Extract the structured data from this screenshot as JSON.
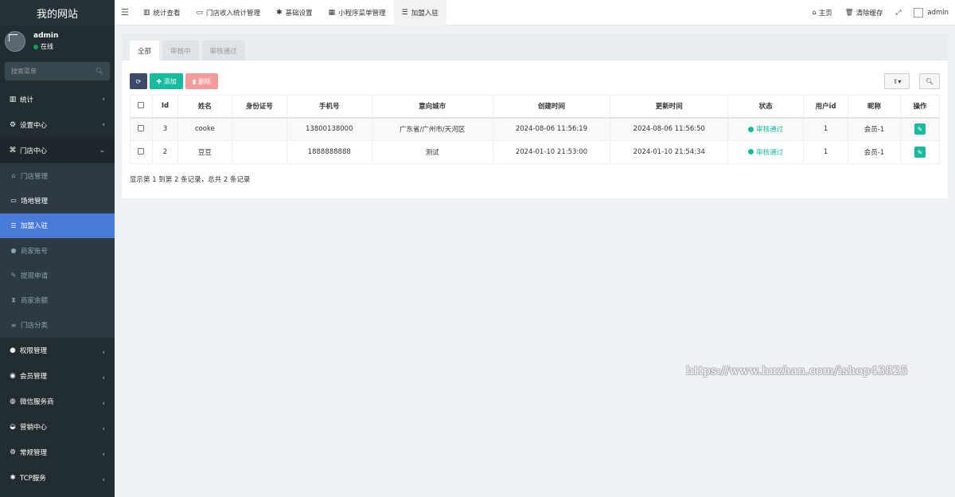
{
  "sidebar": {
    "logo": "我的网站",
    "user": {
      "name": "admin",
      "status": "在线"
    },
    "search_placeholder": "搜索菜单",
    "items": [
      {
        "label": "统计",
        "icon": "bar-chart-icon"
      },
      {
        "label": "设置中心",
        "icon": "cogs-icon"
      },
      {
        "label": "门店中心",
        "icon": "store-icon"
      }
    ],
    "sub_items": [
      {
        "label": "门店管理",
        "icon": "home-icon"
      },
      {
        "label": "场地管理",
        "icon": "laptop-icon"
      },
      {
        "label": "加盟入驻",
        "icon": "list-alt-icon"
      },
      {
        "label": "商家账号",
        "icon": "user-icon"
      },
      {
        "label": "提现申请",
        "icon": "edit-icon"
      },
      {
        "label": "商家余额",
        "icon": "hourglass-icon"
      },
      {
        "label": "门店分类",
        "icon": "list-icon"
      }
    ],
    "groups": [
      {
        "label": "权限管理",
        "icon": "group-icon"
      },
      {
        "label": "会员管理",
        "icon": "user-circle-icon"
      },
      {
        "label": "微信服务商",
        "icon": "wechat-icon"
      },
      {
        "label": "营销中心",
        "icon": "car-icon"
      },
      {
        "label": "常规管理",
        "icon": "cogs-icon"
      },
      {
        "label": "TCP服务",
        "icon": "asterisk-icon"
      }
    ]
  },
  "topbar": {
    "tabs": [
      {
        "label": "统计查看",
        "icon": "area-chart-icon"
      },
      {
        "label": "门店收入统计管理",
        "icon": "window-icon"
      },
      {
        "label": "基础设置",
        "icon": "asterisk-icon"
      },
      {
        "label": "小程序菜单管理",
        "icon": "th-large-icon"
      },
      {
        "label": "加盟入驻",
        "icon": "list-alt-icon"
      }
    ],
    "home": "主页",
    "clear_cache": "清除缓存",
    "admin": "admin"
  },
  "panel": {
    "tabs": [
      "全部",
      "审核中",
      "审核通过"
    ],
    "add_label": "添加",
    "delete_label": "删除",
    "columns": [
      "Id",
      "姓名",
      "身份证号",
      "手机号",
      "意向城市",
      "创建时间",
      "更新时间",
      "状态",
      "用户id",
      "昵称",
      "操作"
    ],
    "rows": [
      {
        "id": "3",
        "name": "cooke",
        "idcard": "",
        "phone": "13800138000",
        "city": "广东省/广州市/天河区",
        "created": "2024-08-06 11:56:19",
        "updated": "2024-08-06 11:56:50",
        "status": "审核通过",
        "uid": "1",
        "nick": "会员-1"
      },
      {
        "id": "2",
        "name": "豆豆",
        "idcard": "",
        "phone": "1888888888",
        "city": "测试",
        "created": "2024-01-10 21:53:00",
        "updated": "2024-01-10 21:54:34",
        "status": "审核通过",
        "uid": "1",
        "nick": "会员-1"
      }
    ],
    "summary": "显示第 1 到第 2 条记录，总共 2 条记录"
  },
  "watermark": "https://www.huzhan.com/ishop43825"
}
